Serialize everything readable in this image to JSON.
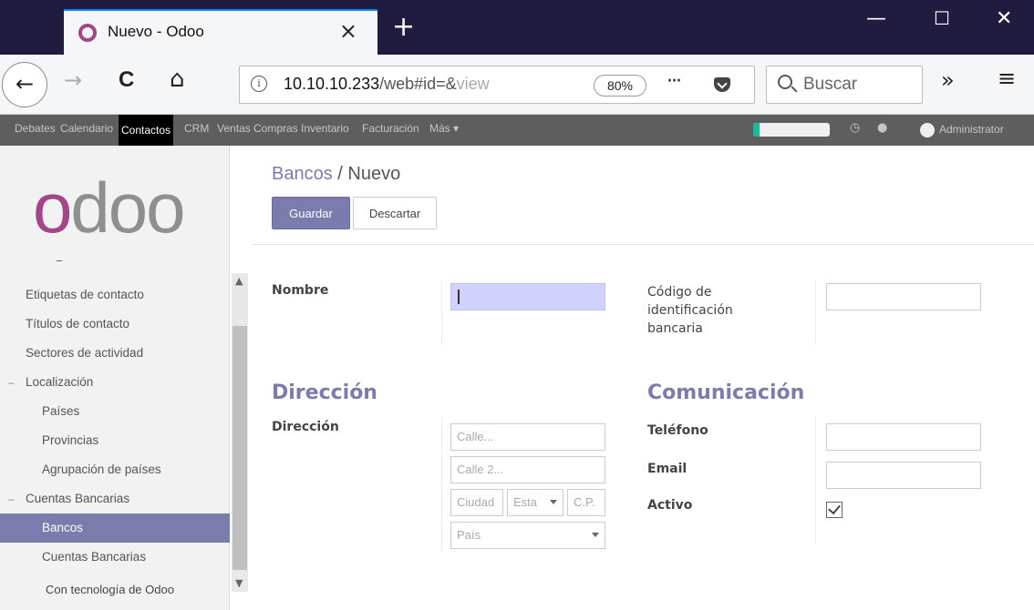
{
  "browser": {
    "tab_title": "Nuevo - Odoo",
    "tab_close": "×",
    "new_tab": "+",
    "window_controls": {
      "minimize": "—",
      "maximize": "☐",
      "close": "✕"
    },
    "nav": {
      "back": "←",
      "forward": "→",
      "reload": "C",
      "home": "⌂"
    },
    "url": {
      "host": "10.10.10.233",
      "path": "/web#id=&",
      "faded": "view"
    },
    "zoom": "80%",
    "page_actions": "···",
    "search_placeholder": "Buscar",
    "overflow": "»",
    "menu": "≡"
  },
  "odoo_menu": {
    "items": [
      {
        "label": "Debates"
      },
      {
        "label": "Calendario"
      },
      {
        "label": "Contactos"
      },
      {
        "label": "CRM"
      },
      {
        "label": "Ventas"
      },
      {
        "label": "Compras"
      },
      {
        "label": "Inventario"
      },
      {
        "label": "Facturación"
      },
      {
        "label": "Más ▾"
      }
    ],
    "progress": 0.08,
    "user": "Administrator"
  },
  "sidebar": {
    "logo": {
      "o1": "o",
      "rest": "doo"
    },
    "items": [
      {
        "label": "Etiquetas de contacto"
      },
      {
        "label": "Títulos de contacto"
      },
      {
        "label": "Sectores de actividad"
      },
      {
        "label": "Localización"
      },
      {
        "label": "Países"
      },
      {
        "label": "Provincias"
      },
      {
        "label": "Agrupación de países"
      },
      {
        "label": "Cuentas Bancarias"
      },
      {
        "label": "Bancos"
      },
      {
        "label": "Cuentas Bancarias"
      }
    ],
    "footer": "Con tecnología de Odoo"
  },
  "main": {
    "breadcrumb": {
      "parent": "Bancos",
      "separator": "/",
      "current": "Nuevo"
    },
    "save_label": "Guardar",
    "discard_label": "Descartar",
    "form": {
      "nombre_label": "Nombre",
      "bic_label": "Código de identificación bancaria",
      "direccion_section": "Dirección",
      "direccion_label": "Dirección",
      "calle_placeholder": "Calle...",
      "calle2_placeholder": "Calle 2...",
      "ciudad_placeholder": "Ciudad",
      "estado_placeholder": "Esta",
      "cp_placeholder": "C.P.",
      "pais_placeholder": "País",
      "comunicacion_section": "Comunicación",
      "telefono_label": "Teléfono",
      "email_label": "Email",
      "activo_label": "Activo",
      "activo_checked": true
    }
  }
}
